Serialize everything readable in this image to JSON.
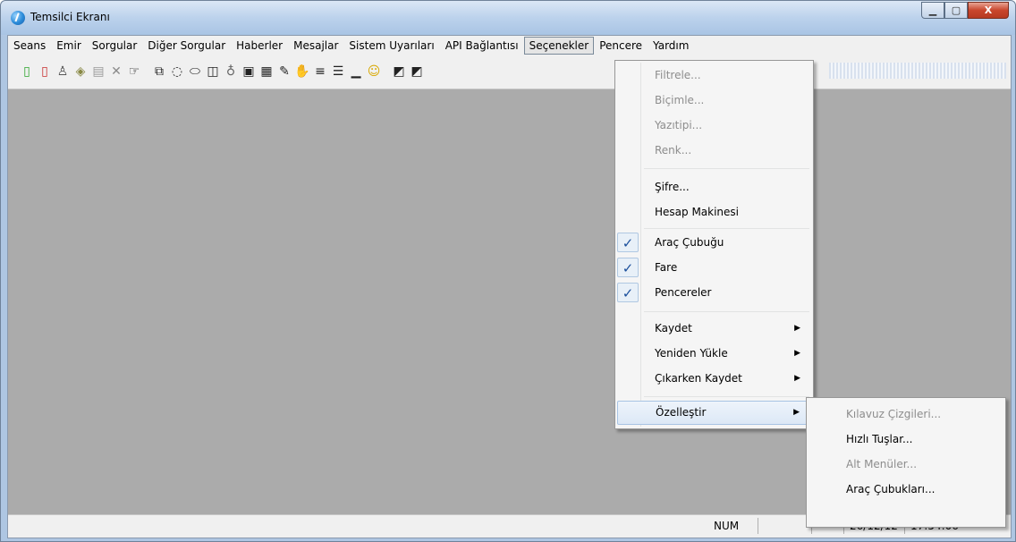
{
  "window": {
    "title": "Temsilci Ekranı",
    "minimize": "▁",
    "maximize": "▢",
    "close": "X"
  },
  "menubar": {
    "items": [
      "Seans",
      "Emir",
      "Sorgular",
      "Diğer Sorgular",
      "Haberler",
      "Mesajlar",
      "Sistem Uyarıları",
      "API Bağlantısı",
      "Seçenekler",
      "Pencere",
      "Yardım"
    ],
    "active": "Seçenekler"
  },
  "toolbar": {
    "icons": [
      {
        "name": "new-document-green-icon",
        "glyph": "▯",
        "color": "#2fa52f"
      },
      {
        "name": "new-document-red-icon",
        "glyph": "▯",
        "color": "#c83030"
      },
      {
        "name": "chess-pawn-icon",
        "glyph": "♙",
        "color": "#444444"
      },
      {
        "name": "ruler-icon",
        "glyph": "◈",
        "color": "#888844"
      },
      {
        "name": "properties-icon",
        "glyph": "▤",
        "color": "#9a9a9a"
      },
      {
        "name": "delete-x-icon",
        "glyph": "✕",
        "color": "#8a8a8a"
      },
      {
        "name": "pointing-hand-icon",
        "glyph": "☞",
        "color": "#222222"
      },
      {
        "name": "window-copy-icon",
        "glyph": "⧉",
        "color": "#222222"
      },
      {
        "name": "chat-bubble-icon",
        "glyph": "◌",
        "color": "#222222"
      },
      {
        "name": "eraser-icon",
        "glyph": "⬭",
        "color": "#222222"
      },
      {
        "name": "columns-icon",
        "glyph": "◫",
        "color": "#222222"
      },
      {
        "name": "bottle-icon",
        "glyph": "♁",
        "color": "#666666"
      },
      {
        "name": "document-a-icon",
        "glyph": "▣",
        "color": "#222222"
      },
      {
        "name": "document-b-icon",
        "glyph": "▦",
        "color": "#222222"
      },
      {
        "name": "edit-pen-icon",
        "glyph": "✎",
        "color": "#222222"
      },
      {
        "name": "hand-stop-icon",
        "glyph": "✋",
        "color": "#222222"
      },
      {
        "name": "list-lines-icon",
        "glyph": "≡",
        "color": "#222222"
      },
      {
        "name": "grid-lines-icon",
        "glyph": "☰",
        "color": "#222222"
      },
      {
        "name": "bar-chart-icon",
        "glyph": "▁",
        "color": "#222222"
      },
      {
        "name": "smiley-icon",
        "glyph": "☺",
        "color": "#d8a800"
      },
      {
        "name": "chart-window-a-icon",
        "glyph": "◩",
        "color": "#222222"
      },
      {
        "name": "chart-window-b-icon",
        "glyph": "◩",
        "color": "#222222"
      }
    ]
  },
  "options_menu": {
    "items": [
      {
        "label": "Filtrele...",
        "disabled": true
      },
      {
        "label": "Biçimle...",
        "disabled": true
      },
      {
        "label": "Yazıtipi...",
        "disabled": true
      },
      {
        "label": "Renk...",
        "disabled": true
      },
      {
        "label": "Şifre...",
        "disabled": false
      },
      {
        "label": "Hesap Makinesi",
        "disabled": false
      },
      {
        "label": "Araç Çubuğu",
        "checked": true
      },
      {
        "label": "Fare",
        "checked": true
      },
      {
        "label": "Pencereler",
        "checked": true
      },
      {
        "label": "Kaydet",
        "submenu": true
      },
      {
        "label": "Yeniden Yükle",
        "submenu": true
      },
      {
        "label": "Çıkarken Kaydet",
        "submenu": true
      },
      {
        "label": "Özelleştir",
        "submenu": true,
        "highlighted": true
      }
    ],
    "check_glyph": "✓",
    "arrow_glyph": "▶"
  },
  "customize_submenu": {
    "items": [
      {
        "label": "Kılavuz Çizgileri...",
        "disabled": true
      },
      {
        "label": "Hızlı Tuşlar...",
        "disabled": false
      },
      {
        "label": "Alt Menüler...",
        "disabled": true
      },
      {
        "label": "Araç Çubukları...",
        "disabled": false
      }
    ]
  },
  "statusbar": {
    "num": "NUM",
    "date": "26/12/12",
    "time": "17:54:06"
  }
}
